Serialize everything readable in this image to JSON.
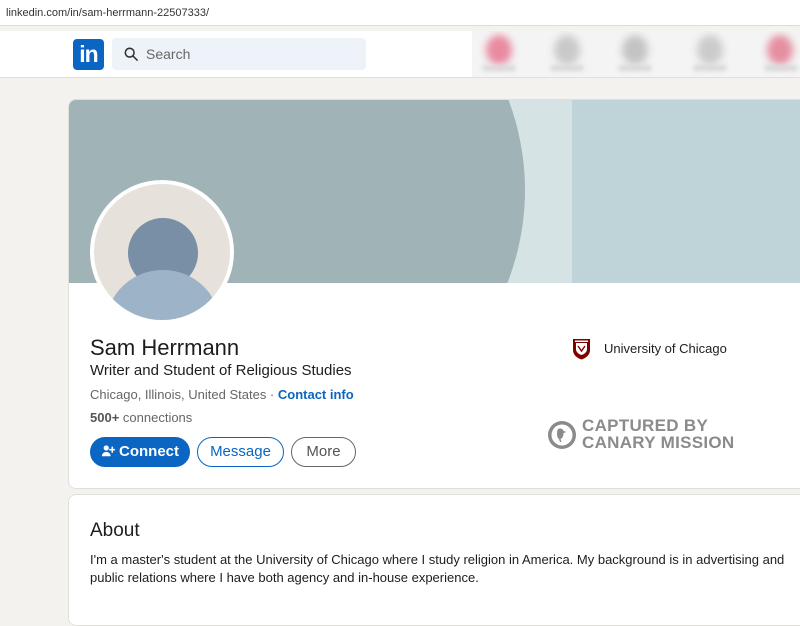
{
  "browser": {
    "url": "linkedin.com/in/sam-herrmann-22507333/"
  },
  "nav": {
    "logo_text": "in",
    "search_placeholder": "Search"
  },
  "profile": {
    "name": "Sam Herrmann",
    "headline": "Writer and Student of Religious Studies",
    "location": "Chicago, Illinois, United States",
    "location_separator": " · ",
    "contact_info": "Contact info",
    "connections_count": "500+",
    "connections_label": " connections",
    "education": "University of Chicago"
  },
  "actions": {
    "connect": "Connect",
    "message": "Message",
    "more": "More"
  },
  "watermark": {
    "line1": "CAPTURED BY",
    "line2": "CANARY MISSION"
  },
  "about": {
    "title": "About",
    "text": "I'm a master's student at the University of Chicago where I study religion in America. My background is in advertising and public relations where I have both agency and in-house experience."
  },
  "colors": {
    "linkedin_blue": "#0a66c2",
    "page_bg": "#f3f2ef",
    "uchicago_maroon": "#800000",
    "watermark_gray": "#8b8b8b"
  }
}
